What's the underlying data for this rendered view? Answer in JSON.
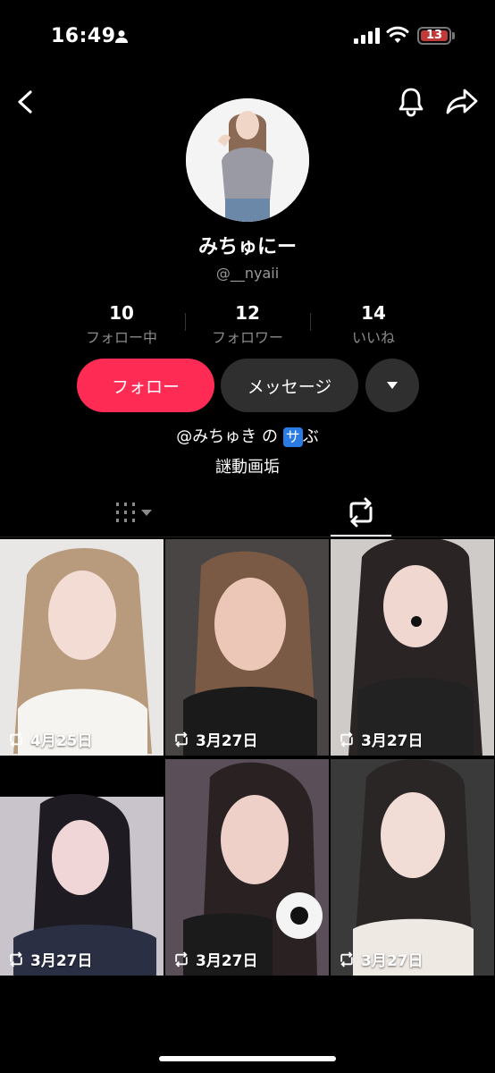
{
  "status_bar": {
    "time": "16:49",
    "battery": "13"
  },
  "profile": {
    "name": "みちゅにー",
    "handle": "@__nyaii",
    "stats": [
      {
        "value": "10",
        "label": "フォロー中"
      },
      {
        "value": "12",
        "label": "フォロワー"
      },
      {
        "value": "14",
        "label": "いいね"
      }
    ],
    "buttons": {
      "follow": "フォロー",
      "message": "メッセージ"
    },
    "bio": {
      "line1_prefix": "@みちゅき の",
      "line1_badge": "サ",
      "line1_suffix": "ぶ",
      "line2": "謎動画垢"
    }
  },
  "tabs": [
    {
      "icon": "grid-icon",
      "active": false
    },
    {
      "icon": "repost-icon",
      "active": true
    }
  ],
  "videos": [
    {
      "date": "4月25日"
    },
    {
      "date": "3月27日"
    },
    {
      "date": "3月27日"
    },
    {
      "date": "3月27日"
    },
    {
      "date": "3月27日"
    },
    {
      "date": "3月27日"
    }
  ],
  "colors": {
    "accent": "#fe2c55",
    "button_dark": "#2f2f2f",
    "background": "#000000"
  }
}
